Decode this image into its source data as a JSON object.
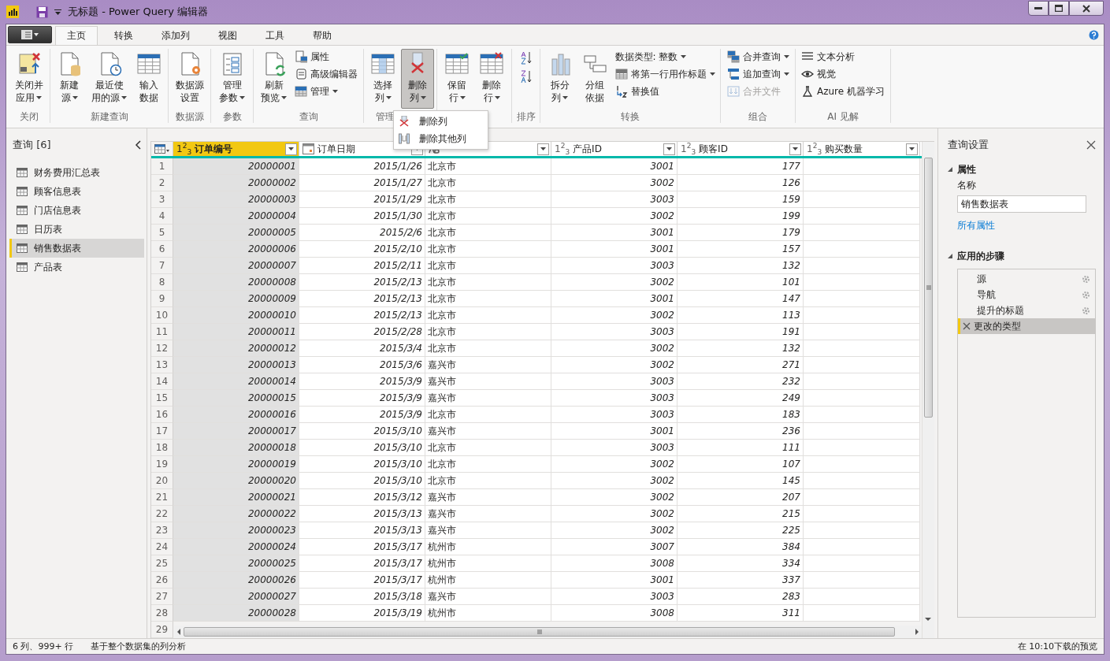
{
  "window": {
    "title": "无标题 - Power Query 编辑器"
  },
  "ribbon_tabs": [
    {
      "label": "主页",
      "selected": true
    },
    {
      "label": "转换",
      "selected": false
    },
    {
      "label": "添加列",
      "selected": false
    },
    {
      "label": "视图",
      "selected": false
    },
    {
      "label": "工具",
      "selected": false
    },
    {
      "label": "帮助",
      "selected": false
    }
  ],
  "ribbon_groups": [
    {
      "label": "关闭",
      "items": [
        {
          "kind": "large",
          "lines": [
            "关闭并",
            "应用"
          ],
          "dropdown": true,
          "pressed": false
        }
      ]
    },
    {
      "label": "新建查询",
      "items": [
        {
          "kind": "large",
          "lines": [
            "新建",
            "源"
          ],
          "dropdown": true,
          "pressed": false
        },
        {
          "kind": "large",
          "lines": [
            "最近使",
            "用的源"
          ],
          "dropdown": true,
          "pressed": false
        },
        {
          "kind": "large",
          "lines": [
            "输入",
            "数据"
          ],
          "dropdown": false,
          "pressed": false
        }
      ]
    },
    {
      "label": "数据源",
      "items": [
        {
          "kind": "large",
          "lines": [
            "数据源",
            "设置"
          ],
          "dropdown": false,
          "pressed": false
        }
      ]
    },
    {
      "label": "参数",
      "items": [
        {
          "kind": "large",
          "lines": [
            "管理",
            "参数"
          ],
          "dropdown": true,
          "pressed": false
        }
      ]
    },
    {
      "label": "查询",
      "items": [
        {
          "kind": "large",
          "lines": [
            "刷新",
            "预览"
          ],
          "dropdown": true,
          "pressed": false
        },
        {
          "kind": "stack",
          "entries": [
            {
              "label": "属性",
              "dropdown": false,
              "disabled": false
            },
            {
              "label": "高级编辑器",
              "dropdown": false,
              "disabled": false
            },
            {
              "label": "管理",
              "dropdown": true,
              "disabled": false
            }
          ]
        }
      ]
    },
    {
      "label": "管理",
      "items": [
        {
          "kind": "large",
          "lines": [
            "选择",
            "列"
          ],
          "dropdown": true,
          "pressed": false
        },
        {
          "kind": "large",
          "lines": [
            "删除",
            "列"
          ],
          "dropdown": true,
          "pressed": true
        }
      ]
    },
    {
      "items": [
        {
          "kind": "large",
          "lines": [
            "保留",
            "行"
          ],
          "dropdown": true,
          "pressed": false
        },
        {
          "kind": "large",
          "lines": [
            "删除",
            "行"
          ],
          "dropdown": true,
          "pressed": false
        }
      ]
    },
    {
      "label": "排序",
      "items": [
        {
          "kind": "sort"
        }
      ]
    },
    {
      "label": "转换",
      "items": [
        {
          "kind": "large",
          "lines": [
            "拆分",
            "列"
          ],
          "dropdown": true,
          "pressed": false
        },
        {
          "kind": "large",
          "lines": [
            "分组",
            "依据"
          ],
          "dropdown": false,
          "pressed": false
        },
        {
          "kind": "stack",
          "entries": [
            {
              "label": "数据类型: 整数",
              "dropdown": true,
              "disabled": false
            },
            {
              "label": "将第一行用作标题",
              "dropdown": true,
              "disabled": false
            },
            {
              "label": "替换值",
              "dropdown": false,
              "disabled": false
            }
          ]
        }
      ]
    },
    {
      "label": "组合",
      "items": [
        {
          "kind": "stack",
          "entries": [
            {
              "label": "合并查询",
              "dropdown": true,
              "disabled": false
            },
            {
              "label": "追加查询",
              "dropdown": true,
              "disabled": false
            },
            {
              "label": "合并文件",
              "dropdown": false,
              "disabled": true
            }
          ]
        }
      ]
    },
    {
      "label": "AI 见解",
      "items": [
        {
          "kind": "stack",
          "entries": [
            {
              "label": "文本分析",
              "dropdown": false,
              "disabled": false
            },
            {
              "label": "视觉",
              "dropdown": false,
              "disabled": false
            },
            {
              "label": "Azure 机器学习",
              "dropdown": false,
              "disabled": false
            }
          ]
        }
      ]
    }
  ],
  "dropdown_menu": [
    {
      "label": "删除列"
    },
    {
      "label": "删除其他列"
    }
  ],
  "queries": {
    "title": "查询 [6]",
    "items": [
      {
        "label": "财务费用汇总表",
        "selected": false
      },
      {
        "label": "顾客信息表",
        "selected": false
      },
      {
        "label": "门店信息表",
        "selected": false
      },
      {
        "label": "日历表",
        "selected": false
      },
      {
        "label": "销售数据表",
        "selected": true
      },
      {
        "label": "产品表",
        "selected": false
      }
    ]
  },
  "table": {
    "columns": [
      {
        "kind": "number",
        "type_label": "1$^{2}$$_{3}$",
        "label": "订单编号",
        "selected": true
      },
      {
        "kind": "date",
        "label": "订单日期",
        "selected": false
      },
      {
        "kind": "text",
        "selected": false
      },
      {
        "kind": "number",
        "type_label": "1$^{2}$$_{3}$",
        "label": "产品ID",
        "selected": false
      },
      {
        "kind": "number",
        "type_label": "1$^{2}$$_{3}$",
        "label": "顾客ID",
        "selected": false
      },
      {
        "kind": "number",
        "type_label": "1$^{2}$$_{3}$",
        "label": "购买数量",
        "selected": false
      }
    ],
    "rows": [
      {
        "n": "1",
        "cells": [
          "20000001",
          "2015/1/26",
          "北京市",
          "3001",
          "177"
        ]
      },
      {
        "n": "2",
        "cells": [
          "20000002",
          "2015/1/27",
          "北京市",
          "3002",
          "126"
        ]
      },
      {
        "n": "3",
        "cells": [
          "20000003",
          "2015/1/29",
          "北京市",
          "3003",
          "159"
        ]
      },
      {
        "n": "4",
        "cells": [
          "20000004",
          "2015/1/30",
          "北京市",
          "3002",
          "199"
        ]
      },
      {
        "n": "5",
        "cells": [
          "20000005",
          "2015/2/6",
          "北京市",
          "3001",
          "179"
        ]
      },
      {
        "n": "6",
        "cells": [
          "20000006",
          "2015/2/10",
          "北京市",
          "3001",
          "157"
        ]
      },
      {
        "n": "7",
        "cells": [
          "20000007",
          "2015/2/11",
          "北京市",
          "3003",
          "132"
        ]
      },
      {
        "n": "8",
        "cells": [
          "20000008",
          "2015/2/13",
          "北京市",
          "3002",
          "101"
        ]
      },
      {
        "n": "9",
        "cells": [
          "20000009",
          "2015/2/13",
          "北京市",
          "3001",
          "147"
        ]
      },
      {
        "n": "10",
        "cells": [
          "20000010",
          "2015/2/13",
          "北京市",
          "3002",
          "113"
        ]
      },
      {
        "n": "11",
        "cells": [
          "20000011",
          "2015/2/28",
          "北京市",
          "3003",
          "191"
        ]
      },
      {
        "n": "12",
        "cells": [
          "20000012",
          "2015/3/4",
          "北京市",
          "3002",
          "132"
        ]
      },
      {
        "n": "13",
        "cells": [
          "20000013",
          "2015/3/6",
          "嘉兴市",
          "3002",
          "271"
        ]
      },
      {
        "n": "14",
        "cells": [
          "20000014",
          "2015/3/9",
          "嘉兴市",
          "3003",
          "232"
        ]
      },
      {
        "n": "15",
        "cells": [
          "20000015",
          "2015/3/9",
          "嘉兴市",
          "3003",
          "249"
        ]
      },
      {
        "n": "16",
        "cells": [
          "20000016",
          "2015/3/9",
          "北京市",
          "3003",
          "183"
        ]
      },
      {
        "n": "17",
        "cells": [
          "20000017",
          "2015/3/10",
          "嘉兴市",
          "3001",
          "236"
        ]
      },
      {
        "n": "18",
        "cells": [
          "20000018",
          "2015/3/10",
          "北京市",
          "3003",
          "111"
        ]
      },
      {
        "n": "19",
        "cells": [
          "20000019",
          "2015/3/10",
          "北京市",
          "3002",
          "107"
        ]
      },
      {
        "n": "20",
        "cells": [
          "20000020",
          "2015/3/10",
          "北京市",
          "3002",
          "145"
        ]
      },
      {
        "n": "21",
        "cells": [
          "20000021",
          "2015/3/12",
          "嘉兴市",
          "3002",
          "207"
        ]
      },
      {
        "n": "22",
        "cells": [
          "20000022",
          "2015/3/13",
          "嘉兴市",
          "3002",
          "215"
        ]
      },
      {
        "n": "23",
        "cells": [
          "20000023",
          "2015/3/13",
          "嘉兴市",
          "3002",
          "225"
        ]
      },
      {
        "n": "24",
        "cells": [
          "20000024",
          "2015/3/17",
          "杭州市",
          "3007",
          "384"
        ]
      },
      {
        "n": "25",
        "cells": [
          "20000025",
          "2015/3/17",
          "杭州市",
          "3008",
          "334"
        ]
      },
      {
        "n": "26",
        "cells": [
          "20000026",
          "2015/3/17",
          "杭州市",
          "3001",
          "337"
        ]
      },
      {
        "n": "27",
        "cells": [
          "20000027",
          "2015/3/18",
          "嘉兴市",
          "3003",
          "283"
        ]
      },
      {
        "n": "28",
        "cells": [
          "20000028",
          "2015/3/19",
          "杭州市",
          "3008",
          "311"
        ]
      }
    ],
    "partial_row": "29"
  },
  "settings": {
    "title": "查询设置",
    "properties_heading": "属性",
    "name_label": "名称",
    "name_value": "销售数据表",
    "all_properties_link": "所有属性",
    "steps_heading": "应用的步骤",
    "steps": [
      {
        "label": "源",
        "has_settings": true,
        "selected": false
      },
      {
        "label": "导航",
        "has_settings": true,
        "selected": false
      },
      {
        "label": "提升的标题",
        "has_settings": true,
        "selected": false
      },
      {
        "label": "更改的类型",
        "has_settings": false,
        "selected": true
      }
    ]
  },
  "status_bar": {
    "summary": "6 列、999+ 行",
    "profiling": "基于整个数据集的列分析",
    "preview_time": "在 10:10下载的预览"
  }
}
